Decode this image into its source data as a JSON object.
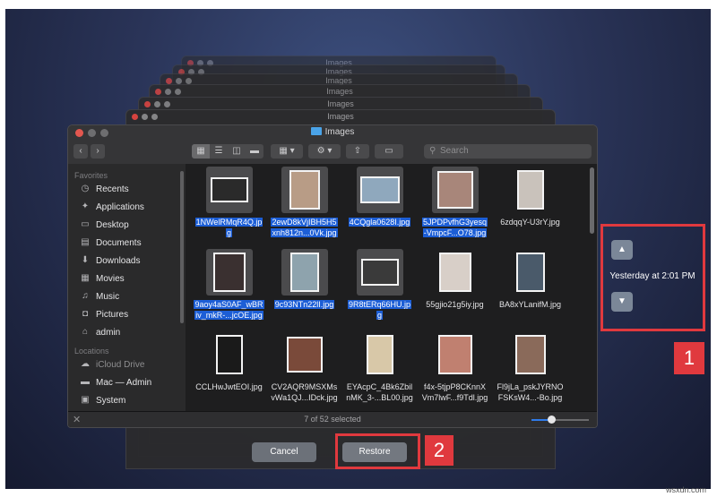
{
  "window": {
    "title": "Images"
  },
  "stacked_windows": [
    "Images",
    "Images",
    "Images",
    "Images",
    "Images",
    "Images"
  ],
  "toolbar": {
    "back_icon": "chevron-left-icon",
    "forward_icon": "chevron-right-icon",
    "search_placeholder": "Search"
  },
  "sidebar": {
    "favorites_header": "Favorites",
    "favorites": [
      {
        "label": "Recents",
        "icon": "clock-icon"
      },
      {
        "label": "Applications",
        "icon": "applications-icon"
      },
      {
        "label": "Desktop",
        "icon": "desktop-icon"
      },
      {
        "label": "Documents",
        "icon": "document-icon"
      },
      {
        "label": "Downloads",
        "icon": "download-icon"
      },
      {
        "label": "Movies",
        "icon": "movie-icon"
      },
      {
        "label": "Music",
        "icon": "music-icon"
      },
      {
        "label": "Pictures",
        "icon": "camera-icon"
      },
      {
        "label": "admin",
        "icon": "home-icon"
      }
    ],
    "locations_header": "Locations",
    "locations": [
      {
        "label": "iCloud Drive",
        "icon": "cloud-icon",
        "dim": true
      },
      {
        "label": "Mac — Admin",
        "icon": "laptop-icon",
        "dim": false
      },
      {
        "label": "System",
        "icon": "disk-icon",
        "dim": false
      }
    ]
  },
  "files": [
    {
      "line1": "1NWelRMqR4Q.jp",
      "line2": "g",
      "selected": true,
      "thumb": "#2a2a2a",
      "w": 42,
      "h": 28
    },
    {
      "line1": "2ewD8kVjIBH5H5",
      "line2": "xnh812n...0Vk.jpg",
      "selected": true,
      "thumb": "#b89c86",
      "w": 34,
      "h": 44
    },
    {
      "line1": "4CQgla0628I.jpg",
      "line2": "",
      "selected": true,
      "thumb": "#8fa8bd",
      "w": 44,
      "h": 30
    },
    {
      "line1": "5JPDPvfhG3yesq",
      "line2": "-VmpcF...O78.jpg",
      "selected": true,
      "thumb": "#a8867a",
      "w": 40,
      "h": 42
    },
    {
      "line1": "6zdqqY-U3rY.jpg",
      "line2": "",
      "selected": false,
      "thumb": "#c9c2bb",
      "w": 30,
      "h": 44
    },
    {
      "line1": "9aoy4aS0AF_wBR",
      "line2": "iv_mkR-...jcOE.jpg",
      "selected": true,
      "thumb": "#3a3030",
      "w": 36,
      "h": 44
    },
    {
      "line1": "9c93NTn22lI.jpg",
      "line2": "",
      "selected": true,
      "thumb": "#8ea3ad",
      "w": 32,
      "h": 44
    },
    {
      "line1": "9R8tERq66HU.jp",
      "line2": "g",
      "selected": true,
      "thumb": "#3a3a3a",
      "w": 42,
      "h": 30
    },
    {
      "line1": "55gjio21g5iy.jpg",
      "line2": "",
      "selected": false,
      "thumb": "#d8cfc8",
      "w": 36,
      "h": 44
    },
    {
      "line1": "BA8xYLanifM.jpg",
      "line2": "",
      "selected": false,
      "thumb": "#4a5a6a",
      "w": 32,
      "h": 44
    },
    {
      "line1": "CCLHwJwtEOI.jpg",
      "line2": "",
      "selected": false,
      "thumb": "#1a1a1a",
      "w": 30,
      "h": 44
    },
    {
      "line1": "CV2AQR9MSXMs",
      "line2": "vWa1QJ...IDck.jpg",
      "selected": false,
      "thumb": "#7a4a3a",
      "w": 40,
      "h": 40
    },
    {
      "line1": "EYAcpC_4Bk6Zbil",
      "line2": "nMK_3-...BL00.jpg",
      "selected": false,
      "thumb": "#d8c8a8",
      "w": 30,
      "h": 44
    },
    {
      "line1": "f4x-5tjpP8CKnnX",
      "line2": "Vm7lwF...f9Tdl.jpg",
      "selected": false,
      "thumb": "#c08070",
      "w": 38,
      "h": 44
    },
    {
      "line1": "Fl9jLa_pskJYRNO",
      "line2": "FSKsW4...-Bo.jpg",
      "selected": false,
      "thumb": "#8a6a5a",
      "w": 34,
      "h": 44
    }
  ],
  "status": {
    "text": "7 of 52 selected",
    "zoom_fraction": 0.35
  },
  "time_machine": {
    "timestamp": "Yesterday at 2:01 PM",
    "up_icon": "chevron-up-icon",
    "down_icon": "chevron-down-icon"
  },
  "buttons": {
    "cancel": "Cancel",
    "restore": "Restore"
  },
  "callouts": {
    "one": "1",
    "two": "2"
  },
  "watermark": "wsxdn.com",
  "colors": {
    "highlight": "#e0393e",
    "selection": "#1c5ed6",
    "folder": "#4aa3e8"
  }
}
